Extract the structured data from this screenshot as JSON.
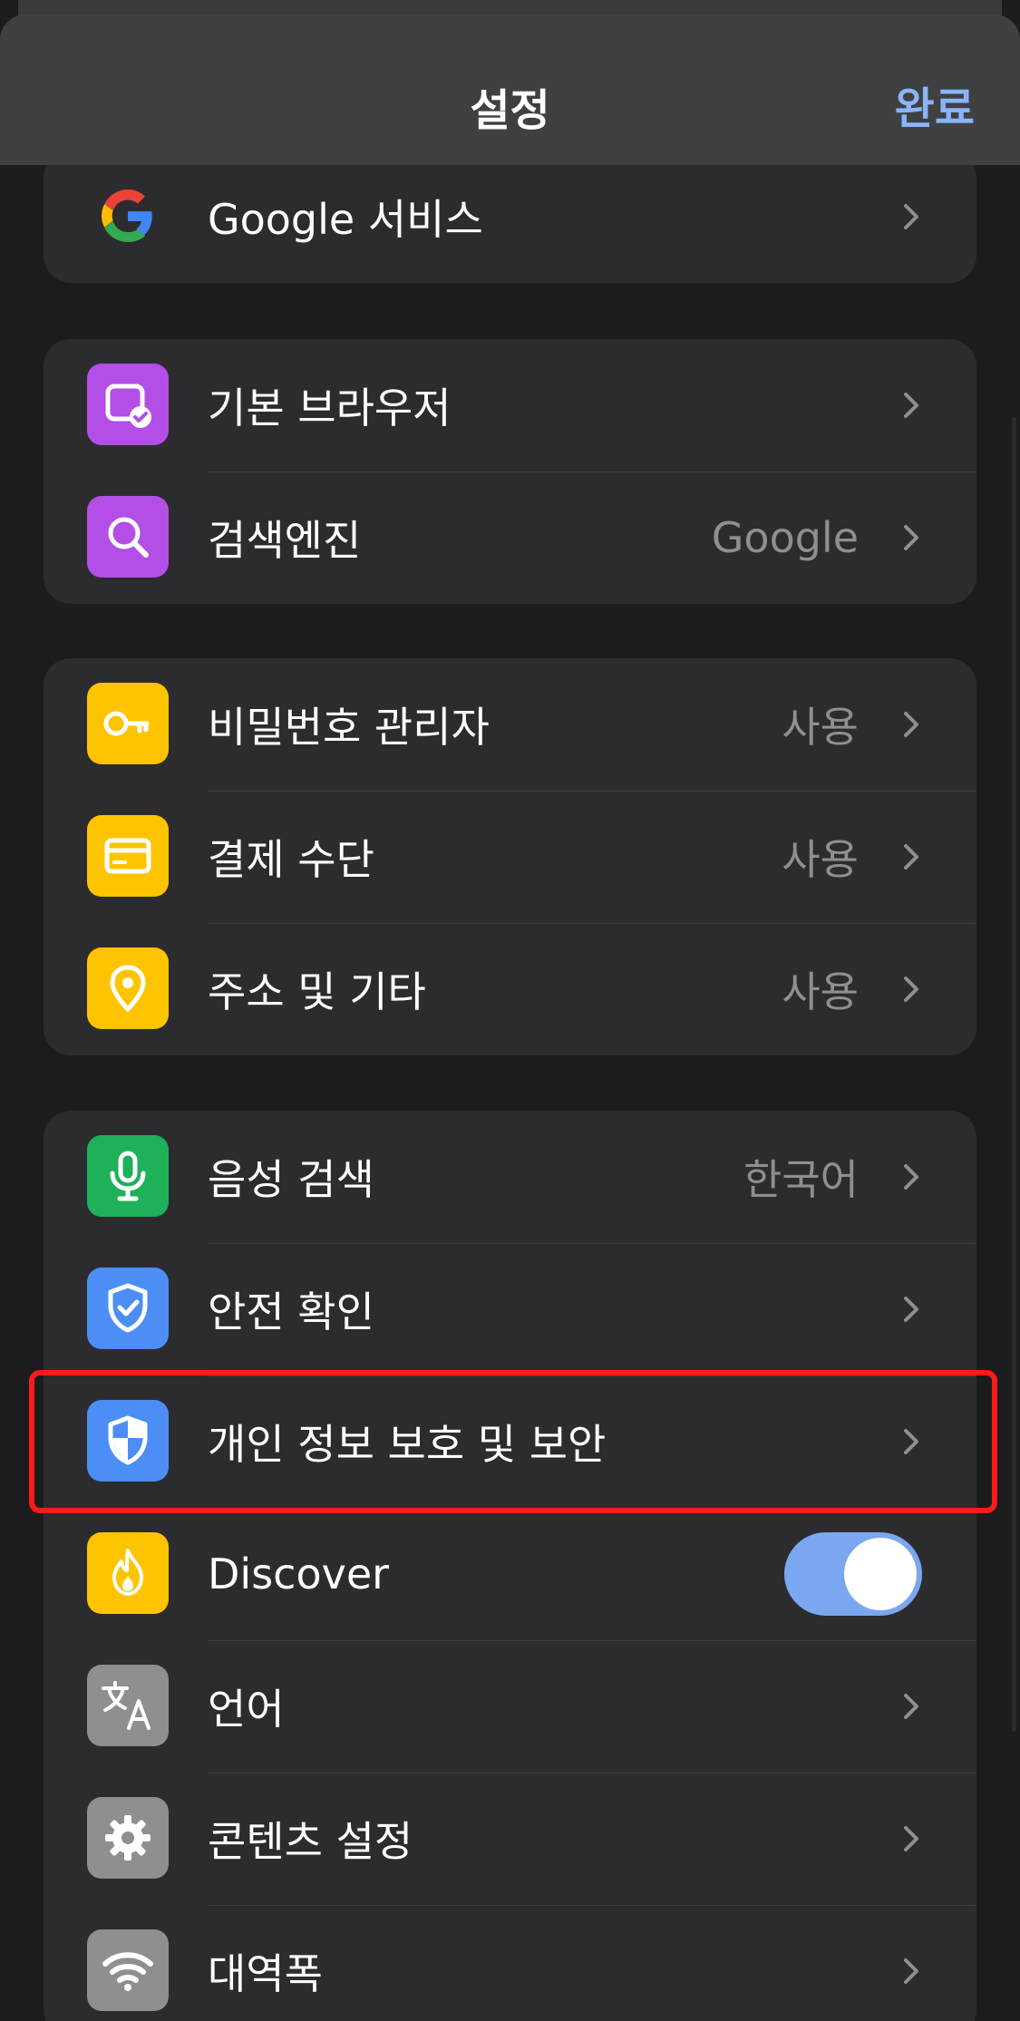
{
  "header": {
    "title": "설정",
    "done_label": "완료"
  },
  "groups": [
    {
      "rows": [
        {
          "label": "Google 서비스",
          "value": "",
          "icon": "google-g-icon"
        }
      ]
    },
    {
      "rows": [
        {
          "label": "기본 브라우저",
          "value": "",
          "icon": "default-browser-icon"
        },
        {
          "label": "검색엔진",
          "value": "Google",
          "icon": "search-icon"
        }
      ]
    },
    {
      "rows": [
        {
          "label": "비밀번호 관리자",
          "value": "사용",
          "icon": "key-icon"
        },
        {
          "label": "결제 수단",
          "value": "사용",
          "icon": "credit-card-icon"
        },
        {
          "label": "주소 및 기타",
          "value": "사용",
          "icon": "location-pin-icon"
        }
      ]
    },
    {
      "rows": [
        {
          "label": "음성 검색",
          "value": "한국어",
          "icon": "microphone-icon"
        },
        {
          "label": "안전 확인",
          "value": "",
          "icon": "shield-check-icon"
        },
        {
          "label": "개인 정보 보호 및 보안",
          "value": "",
          "icon": "privacy-shield-icon",
          "highlighted": true
        },
        {
          "label": "Discover",
          "value": "",
          "icon": "discover-flame-icon",
          "toggle": true,
          "toggle_on": true
        },
        {
          "label": "언어",
          "value": "",
          "icon": "translate-icon"
        },
        {
          "label": "콘텐츠 설정",
          "value": "",
          "icon": "gear-icon"
        },
        {
          "label": "대역폭",
          "value": "",
          "icon": "wifi-icon"
        }
      ]
    }
  ],
  "colors": {
    "accent": "#8ab4f8",
    "purple_tile": "#b34ee6",
    "yellow_tile": "#ffc400",
    "green_tile": "#1fb05a",
    "blue_tile": "#4c8ef5",
    "gray_tile": "#8e8e93",
    "highlight": "#ff1a1a"
  }
}
